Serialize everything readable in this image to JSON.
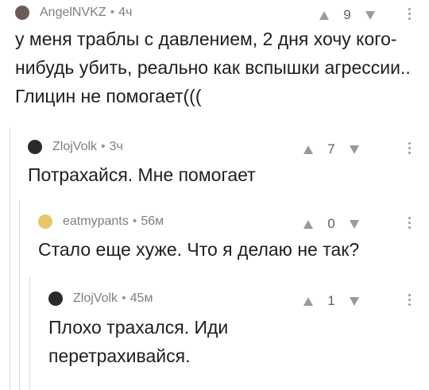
{
  "comments": [
    {
      "author": "AngelNVKZ",
      "time": "4ч",
      "score": "9",
      "text": "у меня траблы с давлением, 2 дня хочу кого-нибудь убить, реально как вспышки агрессии.. Глицин не помогает(((",
      "avatar_color": "#6b5a57"
    },
    {
      "author": "ZlojVolk",
      "time": "3ч",
      "score": "7",
      "text": "Потрахайся. Мне помогает",
      "avatar_color": "#2a2a2a"
    },
    {
      "author": "eatmypants",
      "time": "56м",
      "score": "0",
      "text": "Стало еще хуже. Что я делаю не так?",
      "avatar_color": "#e6c86a"
    },
    {
      "author": "ZlojVolk",
      "time": "45м",
      "score": "1",
      "text": "Плохо трахался. Иди перетрахивайся.",
      "avatar_color": "#2a2a2a"
    }
  ],
  "separator": "•",
  "icons": {
    "upvote": "arrow-up-icon",
    "downvote": "arrow-down-icon",
    "more": "more-vertical-icon"
  },
  "colors": {
    "meta_text": "#7f7f7f",
    "body_text": "#1e1e1e",
    "thread_line": "#d8d8d8",
    "vote_icon": "#9a9a9a"
  }
}
